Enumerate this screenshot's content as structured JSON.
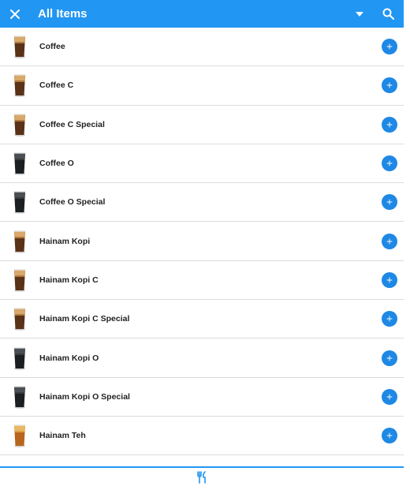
{
  "appbar": {
    "title": "All Items",
    "close_icon": "close-icon",
    "dropdown_icon": "dropdown-arrow-icon",
    "search_icon": "search-icon",
    "color": "#2196f3"
  },
  "items": [
    {
      "name": "Coffee",
      "drink": "brown"
    },
    {
      "name": "Coffee C",
      "drink": "brown"
    },
    {
      "name": "Coffee C Special",
      "drink": "brown"
    },
    {
      "name": "Coffee O",
      "drink": "black"
    },
    {
      "name": "Coffee O Special",
      "drink": "black"
    },
    {
      "name": "Hainam Kopi",
      "drink": "brown"
    },
    {
      "name": "Hainam Kopi C",
      "drink": "brown"
    },
    {
      "name": "Hainam Kopi C Special",
      "drink": "brown"
    },
    {
      "name": "Hainam Kopi O",
      "drink": "black"
    },
    {
      "name": "Hainam Kopi O Special",
      "drink": "black"
    },
    {
      "name": "Hainam Teh",
      "drink": "tea"
    }
  ],
  "bottom_nav": {
    "icon": "utensils-icon"
  },
  "colors": {
    "accent": "#2196f3",
    "add_button": "#1e88e5"
  }
}
